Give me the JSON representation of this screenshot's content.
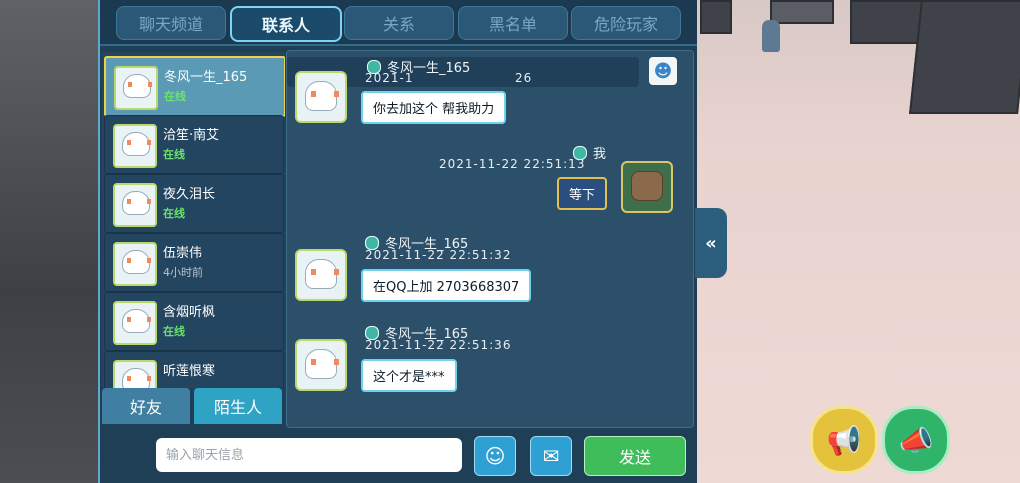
{
  "tabs": [
    "聊天频道",
    "联系人",
    "关系",
    "黑名单",
    "危险玩家"
  ],
  "contacts": [
    {
      "name": "冬风一生_165",
      "status": "在线"
    },
    {
      "name": "洽笙·南艾",
      "status": "在线"
    },
    {
      "name": "夜久泪长",
      "status": "在线"
    },
    {
      "name": "伍崇伟",
      "status": "4小时前"
    },
    {
      "name": "含烟听枫",
      "status": "在线"
    },
    {
      "name": "听莲恨寒",
      "status": ""
    }
  ],
  "friend_tabs": {
    "friends": "好友",
    "strangers": "陌生人"
  },
  "chat": {
    "header_overlap_name": "冬风一生_165",
    "header_overlap_time": "2021-1",
    "header_overlap_time_tail": "26",
    "messages": [
      {
        "sender": "",
        "time": "",
        "text": "你去加这个 帮我助力",
        "mine": false
      },
      {
        "sender": "我",
        "time": "2021-11-22   22:51:13",
        "text": "等下",
        "mine": true
      },
      {
        "sender": "冬风一生_165",
        "time": "2021-11-22   22:51:32",
        "text": "在QQ上加 2703668307",
        "mine": false
      },
      {
        "sender": "冬风一生_165",
        "time": "2021-11-22   22:51:36",
        "text": "这个才是***",
        "mine": false
      }
    ]
  },
  "input": {
    "placeholder": "输入聊天信息",
    "send": "发送"
  },
  "icons": {
    "profile": "person-icon",
    "emoji": "emoji-icon",
    "bubble": "speech-bubble-icon",
    "collapse": "double-chevron-left-icon",
    "horn_yellow": "megaphone-icon",
    "horn_green": "megaphone-icon"
  },
  "colors": {
    "panel": "#1f3f57",
    "online": "#6be36b",
    "send": "#3fbd5a",
    "accent": "#7ed4f2"
  }
}
